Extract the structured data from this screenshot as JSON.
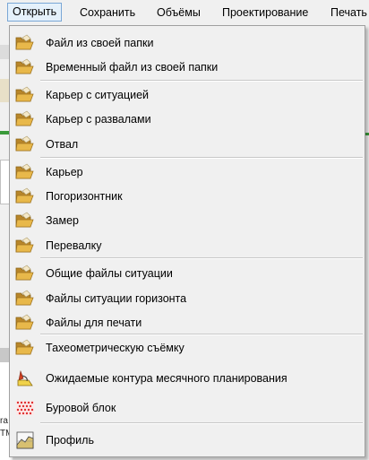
{
  "menubar": {
    "items": [
      {
        "label": "Открыть"
      },
      {
        "label": "Сохранить"
      },
      {
        "label": "Объёмы"
      },
      {
        "label": "Проектирование"
      },
      {
        "label": "Печать"
      }
    ]
  },
  "background": {
    "fragments": [
      "ra",
      "TM"
    ]
  },
  "dropdown": {
    "groups": [
      [
        {
          "label": "Файл из своей папки",
          "icon": "folder-icon"
        },
        {
          "label": "Временный файл из своей папки",
          "icon": "folder-icon"
        }
      ],
      [
        {
          "label": "Карьер с ситуацией",
          "icon": "folder-icon"
        },
        {
          "label": "Карьер с развалами",
          "icon": "folder-icon"
        },
        {
          "label": "Отвал",
          "icon": "folder-icon"
        }
      ],
      [
        {
          "label": "Карьер",
          "icon": "folder-icon"
        },
        {
          "label": "Погоризонтник",
          "icon": "folder-icon"
        },
        {
          "label": "Замер",
          "icon": "folder-icon"
        },
        {
          "label": "Перевалку",
          "icon": "folder-icon"
        }
      ],
      [
        {
          "label": "Общие файлы ситуации",
          "icon": "folder-icon"
        },
        {
          "label": "Файлы ситуации горизонта",
          "icon": "folder-icon"
        },
        {
          "label": "Файлы для печати",
          "icon": "folder-icon"
        }
      ],
      [
        {
          "label": "Тахеометрическую съёмку",
          "icon": "folder-icon"
        },
        {
          "label": "Ожидаемые контура месячного планирования",
          "icon": "contour-icon"
        },
        {
          "label": "Буровой блок",
          "icon": "drill-block-icon"
        }
      ],
      [
        {
          "label": "Профиль",
          "icon": "profile-chart-icon"
        }
      ]
    ]
  },
  "colors": {
    "folder": "#e8b84a",
    "folder_dark": "#b8862a",
    "drill_block": "#e03030",
    "accent_active": "#7aa7d6"
  }
}
